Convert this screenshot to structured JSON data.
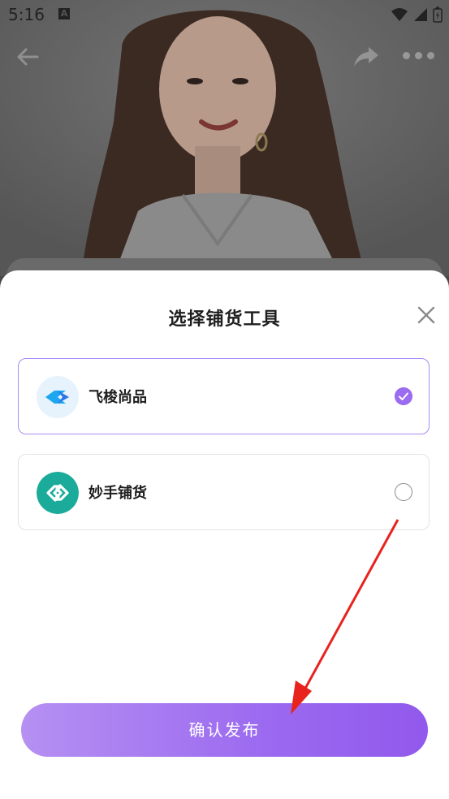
{
  "status_bar": {
    "time": "5:16",
    "notif_letter": "A"
  },
  "sheet": {
    "title": "选择铺货工具",
    "options": [
      {
        "label": "飞梭尚品",
        "selected": true,
        "icon": "feisuo-logo-icon"
      },
      {
        "label": "妙手铺货",
        "selected": false,
        "icon": "miaoshou-logo-icon"
      }
    ],
    "confirm_label": "确认发布"
  },
  "colors": {
    "accent": "#9b6bf0",
    "selected_border": "#a88cf0",
    "annotation_arrow": "#e8231e"
  }
}
